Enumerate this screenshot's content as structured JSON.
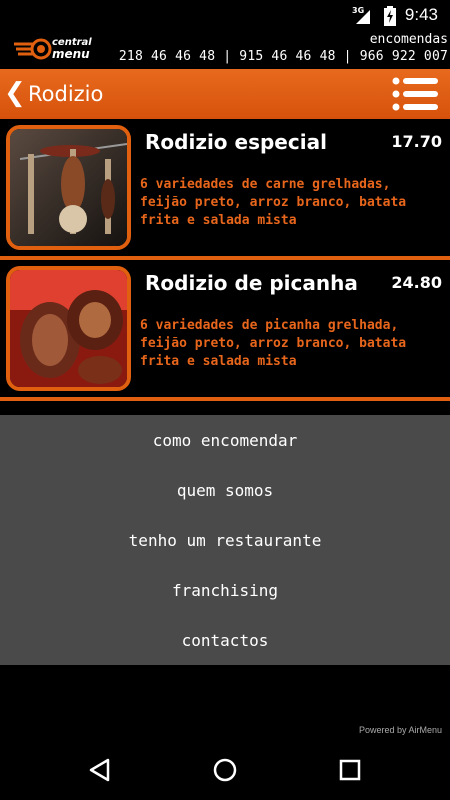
{
  "status_bar": {
    "network": "3G",
    "time": "9:43"
  },
  "app_header": {
    "brand_line1": "central",
    "brand_line2": "menu",
    "orders_label": "encomendas",
    "phones": "218 46 46 48 | 915 46 46 48 | 966 922 007"
  },
  "toolbar": {
    "back_label": "❮",
    "title": "Rodizio"
  },
  "items": [
    {
      "name": "Rodizio especial",
      "price": "17.70",
      "description": "6 variedades de carne grelhadas, feijão preto, arroz branco, batata frita e salada mista"
    },
    {
      "name": "Rodizio de picanha",
      "price": "24.80",
      "description": "6 variedades de picanha grelhada, feijão preto, arroz branco, batata frita e salada mista"
    }
  ],
  "footer_menu": [
    {
      "label": "como encomendar"
    },
    {
      "label": "quem somos"
    },
    {
      "label": "tenho um restaurante"
    },
    {
      "label": "franchising"
    },
    {
      "label": "contactos"
    }
  ],
  "powered_by": "Powered by AirMenu",
  "colors": {
    "accent": "#e0600f",
    "footer_bg": "#4a4a4a"
  },
  "icons": {
    "back": "chevron-left-icon",
    "menu": "list-menu-icon",
    "nav_back": "triangle-back-icon",
    "nav_home": "circle-home-icon",
    "nav_recents": "square-recents-icon"
  }
}
